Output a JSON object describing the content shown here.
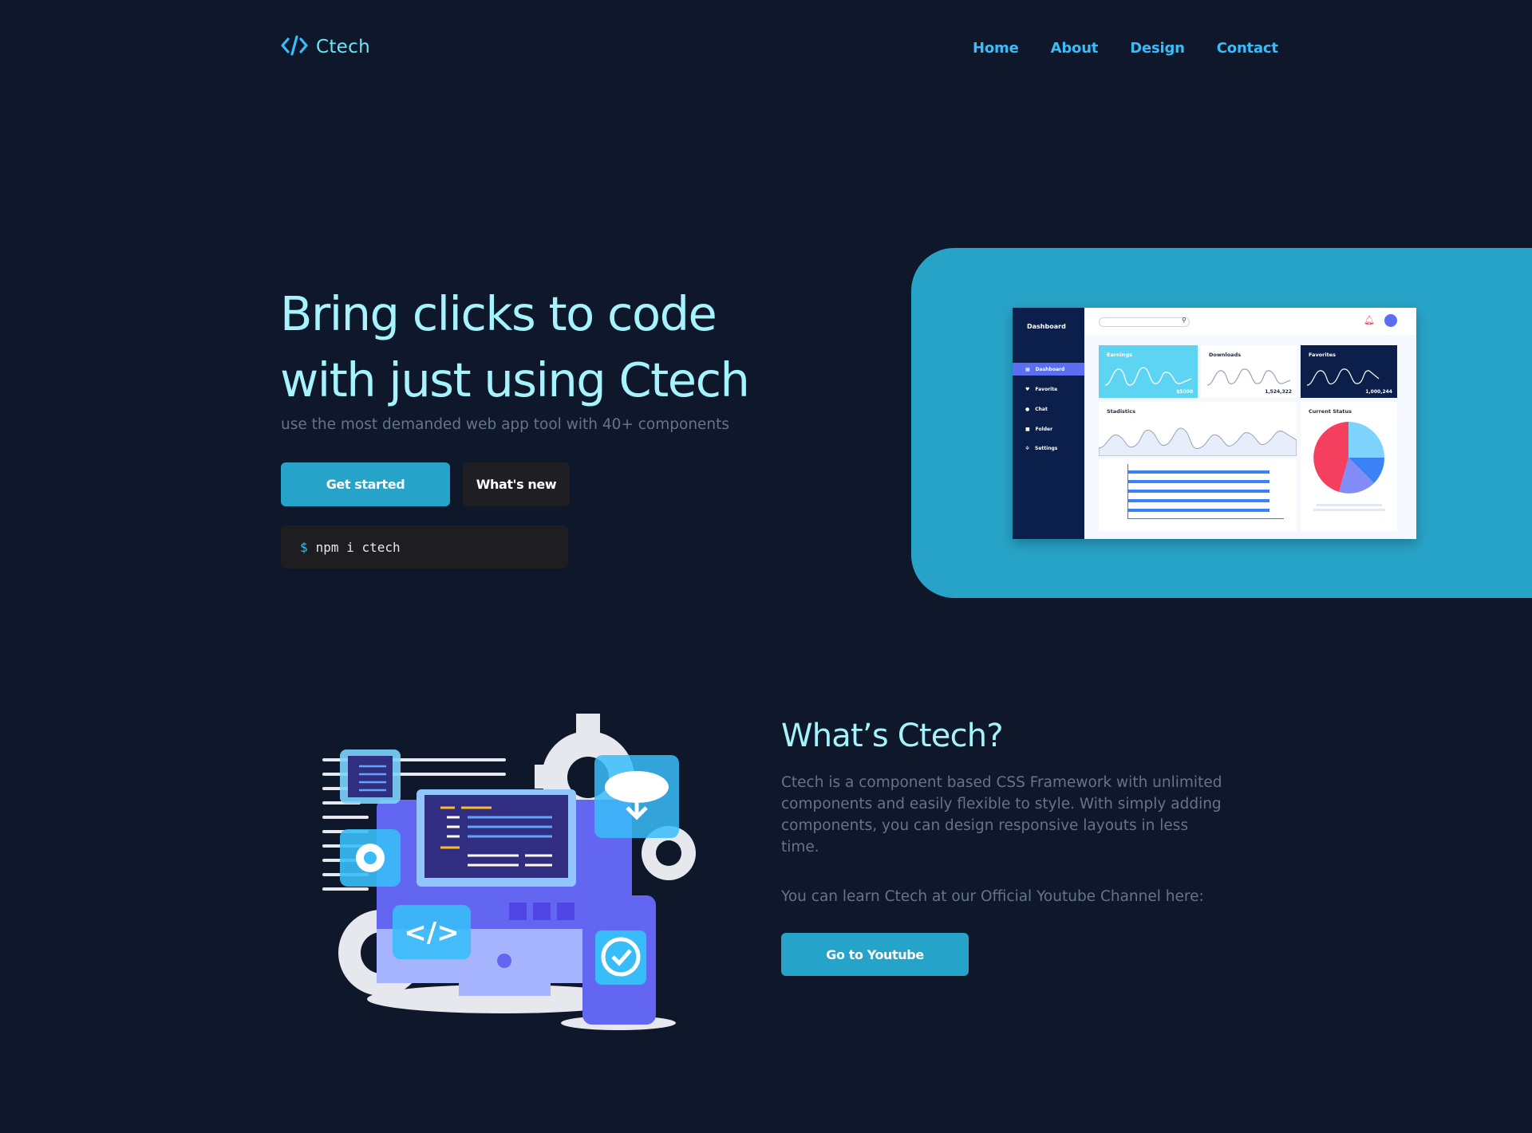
{
  "nav": {
    "logo_text": "Ctech",
    "links": [
      "Home",
      "About",
      "Design",
      "Contact"
    ]
  },
  "hero": {
    "title_line1": "Bring clicks to code",
    "title_line2": "with just using Ctech",
    "subtitle": "use the most demanded web app tool with 40+ components",
    "primary_label": "Get started",
    "secondary_label": "What's new",
    "command_prompt": "$",
    "command": "npm i ctech"
  },
  "dashboard": {
    "title": "Dashboard",
    "menu": [
      "Dashboard",
      "Favorite",
      "Chat",
      "Folder",
      "Settings"
    ],
    "cards": {
      "earnings": {
        "label": "Earnings",
        "value": "$5000"
      },
      "downloads": {
        "label": "Downloads",
        "value": "1,524,322"
      },
      "favorites": {
        "label": "Favorites",
        "value": "1,000,244"
      },
      "statistics": {
        "label": "Stadistics"
      },
      "status": {
        "label": "Current Status"
      }
    }
  },
  "about": {
    "title": "What’s Ctech?",
    "description": "Ctech is a component based CSS Framework with unlimited components and easily flexible to style. With simply adding components, you can design responsive layouts in less time.",
    "learn_text": "You can learn Ctech at our Official Youtube Channel here:",
    "button_label": "Go to Youtube"
  },
  "colors": {
    "background": "#0f172a",
    "accent": "#25a3c8",
    "heading": "#a5f3fc",
    "nav_link": "#38bdf8"
  }
}
